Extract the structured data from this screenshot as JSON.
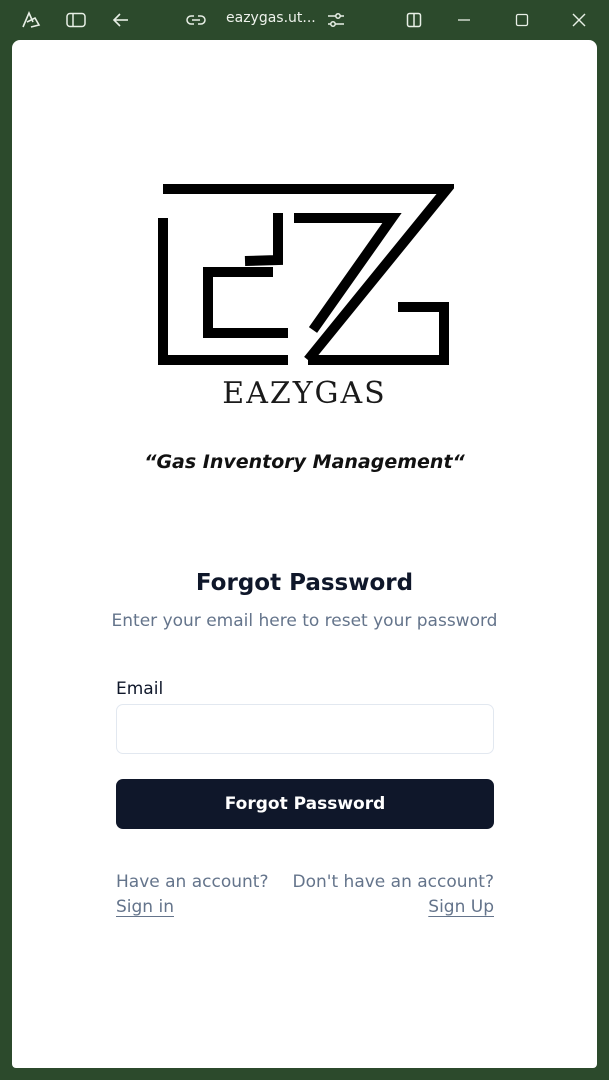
{
  "browser": {
    "url": "eazygas.ut...",
    "icons": [
      "app-icon",
      "sidebar-icon",
      "back-arrow-icon",
      "link-icon",
      "tune-icon",
      "split-view-icon",
      "minimize-icon",
      "maximize-icon",
      "close-icon"
    ]
  },
  "brand": {
    "name": "EAZYGAS",
    "tagline": "“Gas Inventory Management“"
  },
  "form": {
    "title": "Forgot Password",
    "subtitle": "Enter your email here to reset your password",
    "email_label": "Email",
    "email_value": "",
    "email_placeholder": "",
    "submit_label": "Forgot Password"
  },
  "links": {
    "have_account": "Have an account?",
    "sign_in": "Sign in",
    "no_account": "Don't have an account?",
    "sign_up": "Sign Up"
  },
  "colors": {
    "frame": "#2c4a2c",
    "button": "#0f172a",
    "muted_text": "#64748b",
    "input_border": "#e2e8f0"
  }
}
